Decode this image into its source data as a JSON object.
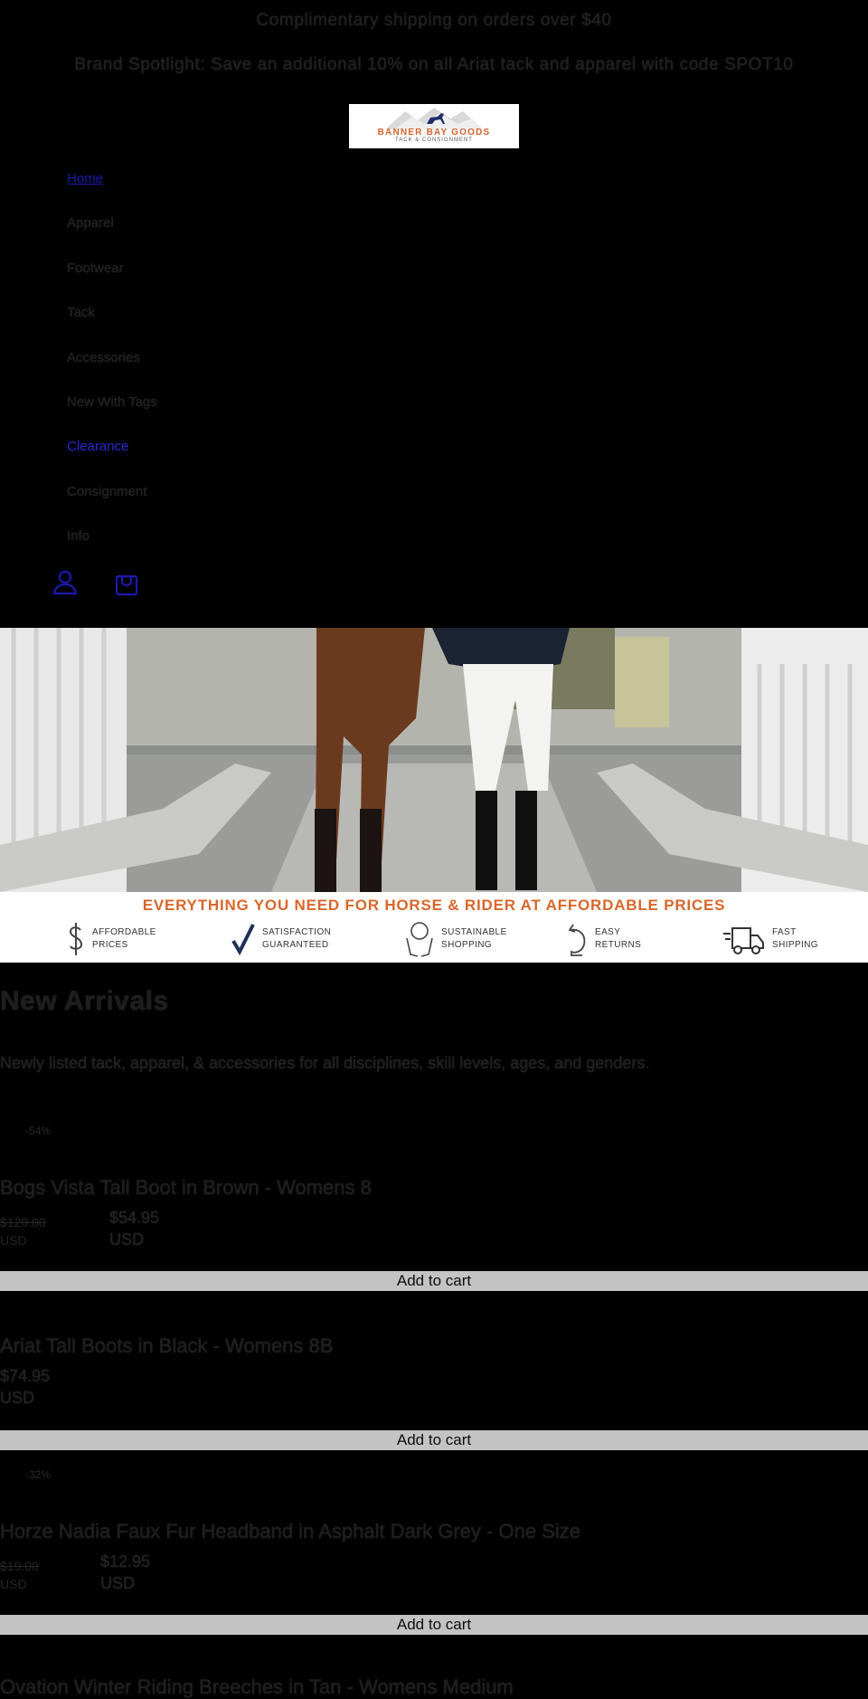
{
  "announcements": [
    "Complimentary shipping on orders over $40",
    "Brand Spotlight: Save an additional 10% on all Ariat tack and apparel with code SPOT10"
  ],
  "logo": {
    "brand": "BANNER BAY GOODS",
    "subtitle": "TACK & CONSIGNMENT"
  },
  "nav": {
    "items": [
      {
        "label": "Home"
      },
      {
        "label": "Apparel"
      },
      {
        "label": "Footwear"
      },
      {
        "label": "Tack"
      },
      {
        "label": "Accessories"
      },
      {
        "label": "New With Tags"
      },
      {
        "label": "Clearance"
      },
      {
        "label": "Consignment"
      },
      {
        "label": "Info"
      }
    ]
  },
  "header_icons": [
    "account-icon",
    "cart-icon"
  ],
  "hero": {
    "tagline": "EVERYTHING YOU NEED FOR HORSE & RIDER AT AFFORDABLE PRICES",
    "features": [
      {
        "icon": "dollar-icon",
        "label": "AFFORDABLE PRICES"
      },
      {
        "icon": "check-icon",
        "label": "SATISFACTION GUARANTEED"
      },
      {
        "icon": "hands-globe-icon",
        "label": "SUSTAINABLE SHOPPING"
      },
      {
        "icon": "return-arrow-icon",
        "label": "EASY RETURNS"
      },
      {
        "icon": "truck-icon",
        "label": "FAST SHIPPING"
      }
    ]
  },
  "new_arrivals": {
    "title": "New Arrivals",
    "description": "Newly listed tack, apparel, & accessories for all disciplines, skill levels, ages, and genders."
  },
  "products": [
    {
      "badge": "-54%",
      "title": "Bogs Vista Tall Boot in Brown - Womens 8",
      "original_price": "$120.00",
      "original_currency": "USD",
      "price": "$54.95",
      "currency": "USD",
      "button": "Add to cart"
    },
    {
      "title": "Ariat Tall Boots in Black - Womens 8B",
      "price": "$74.95",
      "currency": "USD",
      "button": "Add to cart"
    },
    {
      "badge": "-32%",
      "title": "Horze Nadia Faux Fur Headband in Asphalt Dark Grey - One Size",
      "original_price": "$19.00",
      "original_currency": "USD",
      "price": "$12.95",
      "currency": "USD",
      "button": "Add to cart"
    },
    {
      "title": "Ovation Winter Riding Breeches in Tan - Womens Medium"
    }
  ],
  "colors": {
    "background": "#000000",
    "link_active": "#1a1aa8",
    "clearance": "#2a2ad0",
    "accent_orange": "#d9662b",
    "button_bg": "#c3c3c3"
  }
}
